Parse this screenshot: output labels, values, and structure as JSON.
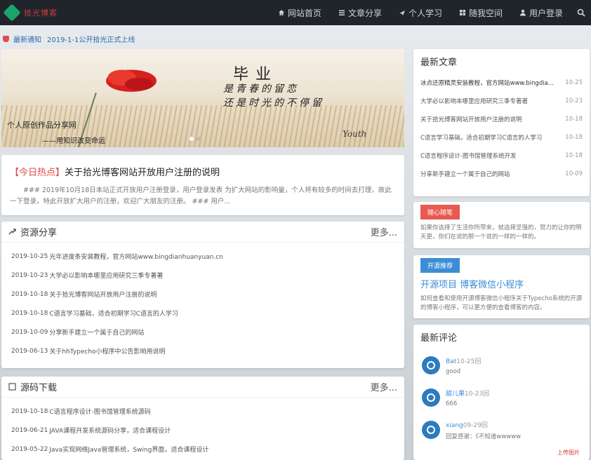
{
  "nav": {
    "logo_text": "拾光博客",
    "items": [
      {
        "label": "网站首页",
        "icon": "home-icon"
      },
      {
        "label": "文章分享",
        "icon": "list-icon"
      },
      {
        "label": "个人学习",
        "icon": "plane-icon"
      },
      {
        "label": "随我空间",
        "icon": "grid-icon"
      },
      {
        "label": "用户登录",
        "icon": "user-icon"
      }
    ]
  },
  "notice": {
    "tag": "最新通知",
    "text": "2019-1-1公开拾光正式上线"
  },
  "banner": {
    "big": "毕业",
    "line1": "是青春的留恋",
    "line2": "还是时光的不停留",
    "left1": "个人原创作品分享网",
    "left2": "——用知识改变命运",
    "sig": "Youth"
  },
  "headline": {
    "hot": "【今日热点】",
    "title": "关于拾光博客网站开放用户注册的说明",
    "summary": "### 2019年10月18日本站正式开放用户注册登录，用户登录发表 为扩大网站的影响量，个人将有较多的时间去打理，故此一下登录，特此开放扩大用户的注册，欢迎广大朋友的注册。 ### 用户..."
  },
  "resources": {
    "title": "资源分享",
    "more": "更多...",
    "rows": [
      {
        "date": "2019-10-25",
        "text": "光年进度条安装教程，官方网站www.bingdianhuanyuan.cn"
      },
      {
        "date": "2019-10-23",
        "text": "大学必以影响本哪里应用研究三季专著著"
      },
      {
        "date": "2019-10-18",
        "text": "关于拾光博客网站开放用户注册的说明"
      },
      {
        "date": "2019-10-18",
        "text": "C语言学习基础，适合初期学习C语言的人学习"
      },
      {
        "date": "2019-10-09",
        "text": "分享新手建立一个属于自己的网站"
      },
      {
        "date": "2019-06-13",
        "text": "关于hhTypecho小程序中公告影响用说明"
      }
    ]
  },
  "downloads": {
    "title": "源码下载",
    "more": "更多...",
    "rows": [
      {
        "date": "2019-10-18",
        "text": "C语言程序设计-图书馆管理系统源码"
      },
      {
        "date": "2019-06-21",
        "text": "JAVA课程开发系统源码分享，适合课程设计"
      },
      {
        "date": "2019-05-22",
        "text": "Java实现网络Java管理系统，Swing界面，适合课程设计"
      }
    ]
  },
  "latest": {
    "title": "最新文章",
    "rows": [
      {
        "text": "冰点还原精灵安装教程，官方网站www.bingdia...",
        "date": "10-25"
      },
      {
        "text": "大学必以影响本哪里应用研究三季专著著",
        "date": "10-23"
      },
      {
        "text": "关于拾光博客网站开放用户注册的说明",
        "date": "10-18"
      },
      {
        "text": "C语言学习基础，适合初期学习C语言的人学习",
        "date": "10-18"
      },
      {
        "text": "C语言程序设计-图书馆管理系统开发",
        "date": "10-18"
      },
      {
        "text": "分享新手建立一个属于自己的网站",
        "date": "10-09"
      }
    ]
  },
  "motto": {
    "badge": "随心随笔",
    "text": "如果你选择了生活你所带来，就选择坚强的，努力的让你的明天更，你们在说的那一个说的一样的一样的。"
  },
  "project": {
    "badge": "开源推荐",
    "title": "开源项目 博客微信小程序",
    "text": "如何查看和使用开源博客微信小程序关于Typecho系统的开源的博客小程序，可以更方便的查看博客的内容。"
  },
  "comments": {
    "title": "最新评论",
    "items": [
      {
        "name": "Bat",
        "date": "10-25回",
        "text": "good"
      },
      {
        "name": "甜儿果",
        "date": "10-23回",
        "text": "666"
      },
      {
        "name": "xiang",
        "date": "09-29回",
        "text": "回复感谢：《不知道wwwww"
      }
    ]
  },
  "watermark": "上传图片"
}
